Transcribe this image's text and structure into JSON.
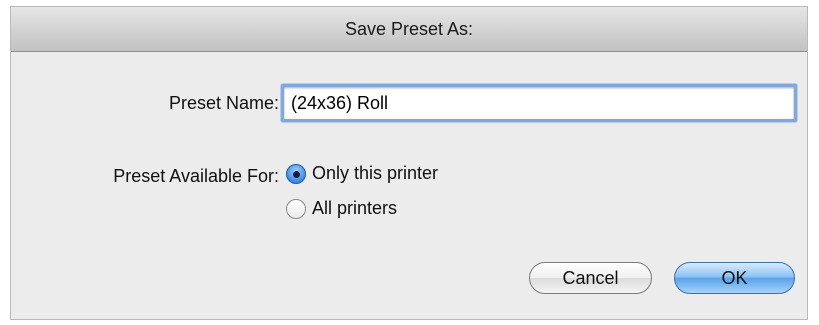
{
  "dialog": {
    "title": "Save Preset As:",
    "preset_name": {
      "label": "Preset Name:",
      "value": "(24x36) Roll"
    },
    "availability": {
      "label": "Preset Available For:",
      "options": [
        {
          "label": "Only this printer",
          "selected": true
        },
        {
          "label": "All printers",
          "selected": false
        }
      ]
    },
    "buttons": {
      "cancel": "Cancel",
      "ok": "OK"
    }
  }
}
